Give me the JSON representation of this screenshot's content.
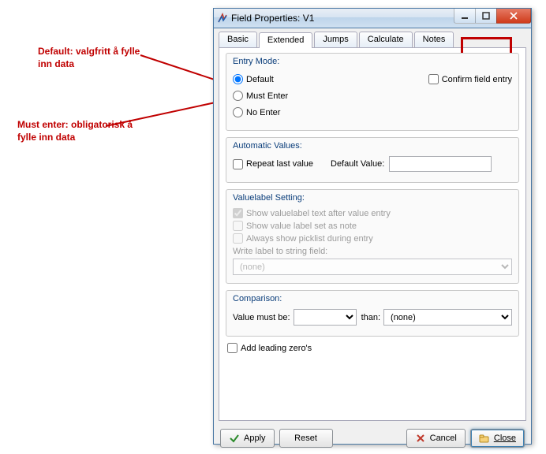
{
  "annotations": {
    "default": "Default: valgfritt å fylle inn data",
    "must_enter": "Must enter: obligatorisk å fylle inn data"
  },
  "window": {
    "title": "Field Properties: V1",
    "tabs": [
      "Basic",
      "Extended",
      "Jumps",
      "Calculate",
      "Notes"
    ],
    "active_tab": 1
  },
  "entry_mode": {
    "title": "Entry Mode:",
    "options": {
      "default": "Default",
      "must_enter": "Must Enter",
      "no_enter": "No Enter"
    },
    "selected": "default",
    "confirm_label": "Confirm field entry",
    "confirm_checked": false
  },
  "automatic": {
    "title": "Automatic Values:",
    "repeat_label": "Repeat last value",
    "repeat_checked": false,
    "default_value_label": "Default Value:",
    "default_value": ""
  },
  "valuelabel": {
    "title": "Valuelabel Setting:",
    "show_after_label": "Show valuelabel text after value entry",
    "show_after_checked": true,
    "set_as_note_label": "Show value label set as note",
    "set_as_note_checked": false,
    "picklist_label": "Always show picklist during entry",
    "picklist_checked": false,
    "write_label_label": "Write label to string field:",
    "write_label_value": "(none)"
  },
  "comparison": {
    "title": "Comparison:",
    "prefix": "Value must be:",
    "op": "",
    "middle": "than:",
    "field": "(none)"
  },
  "leading_zero": {
    "label": "Add leading zero's",
    "checked": false
  },
  "buttons": {
    "apply": "Apply",
    "reset": "Reset",
    "cancel": "Cancel",
    "close": "Close"
  }
}
